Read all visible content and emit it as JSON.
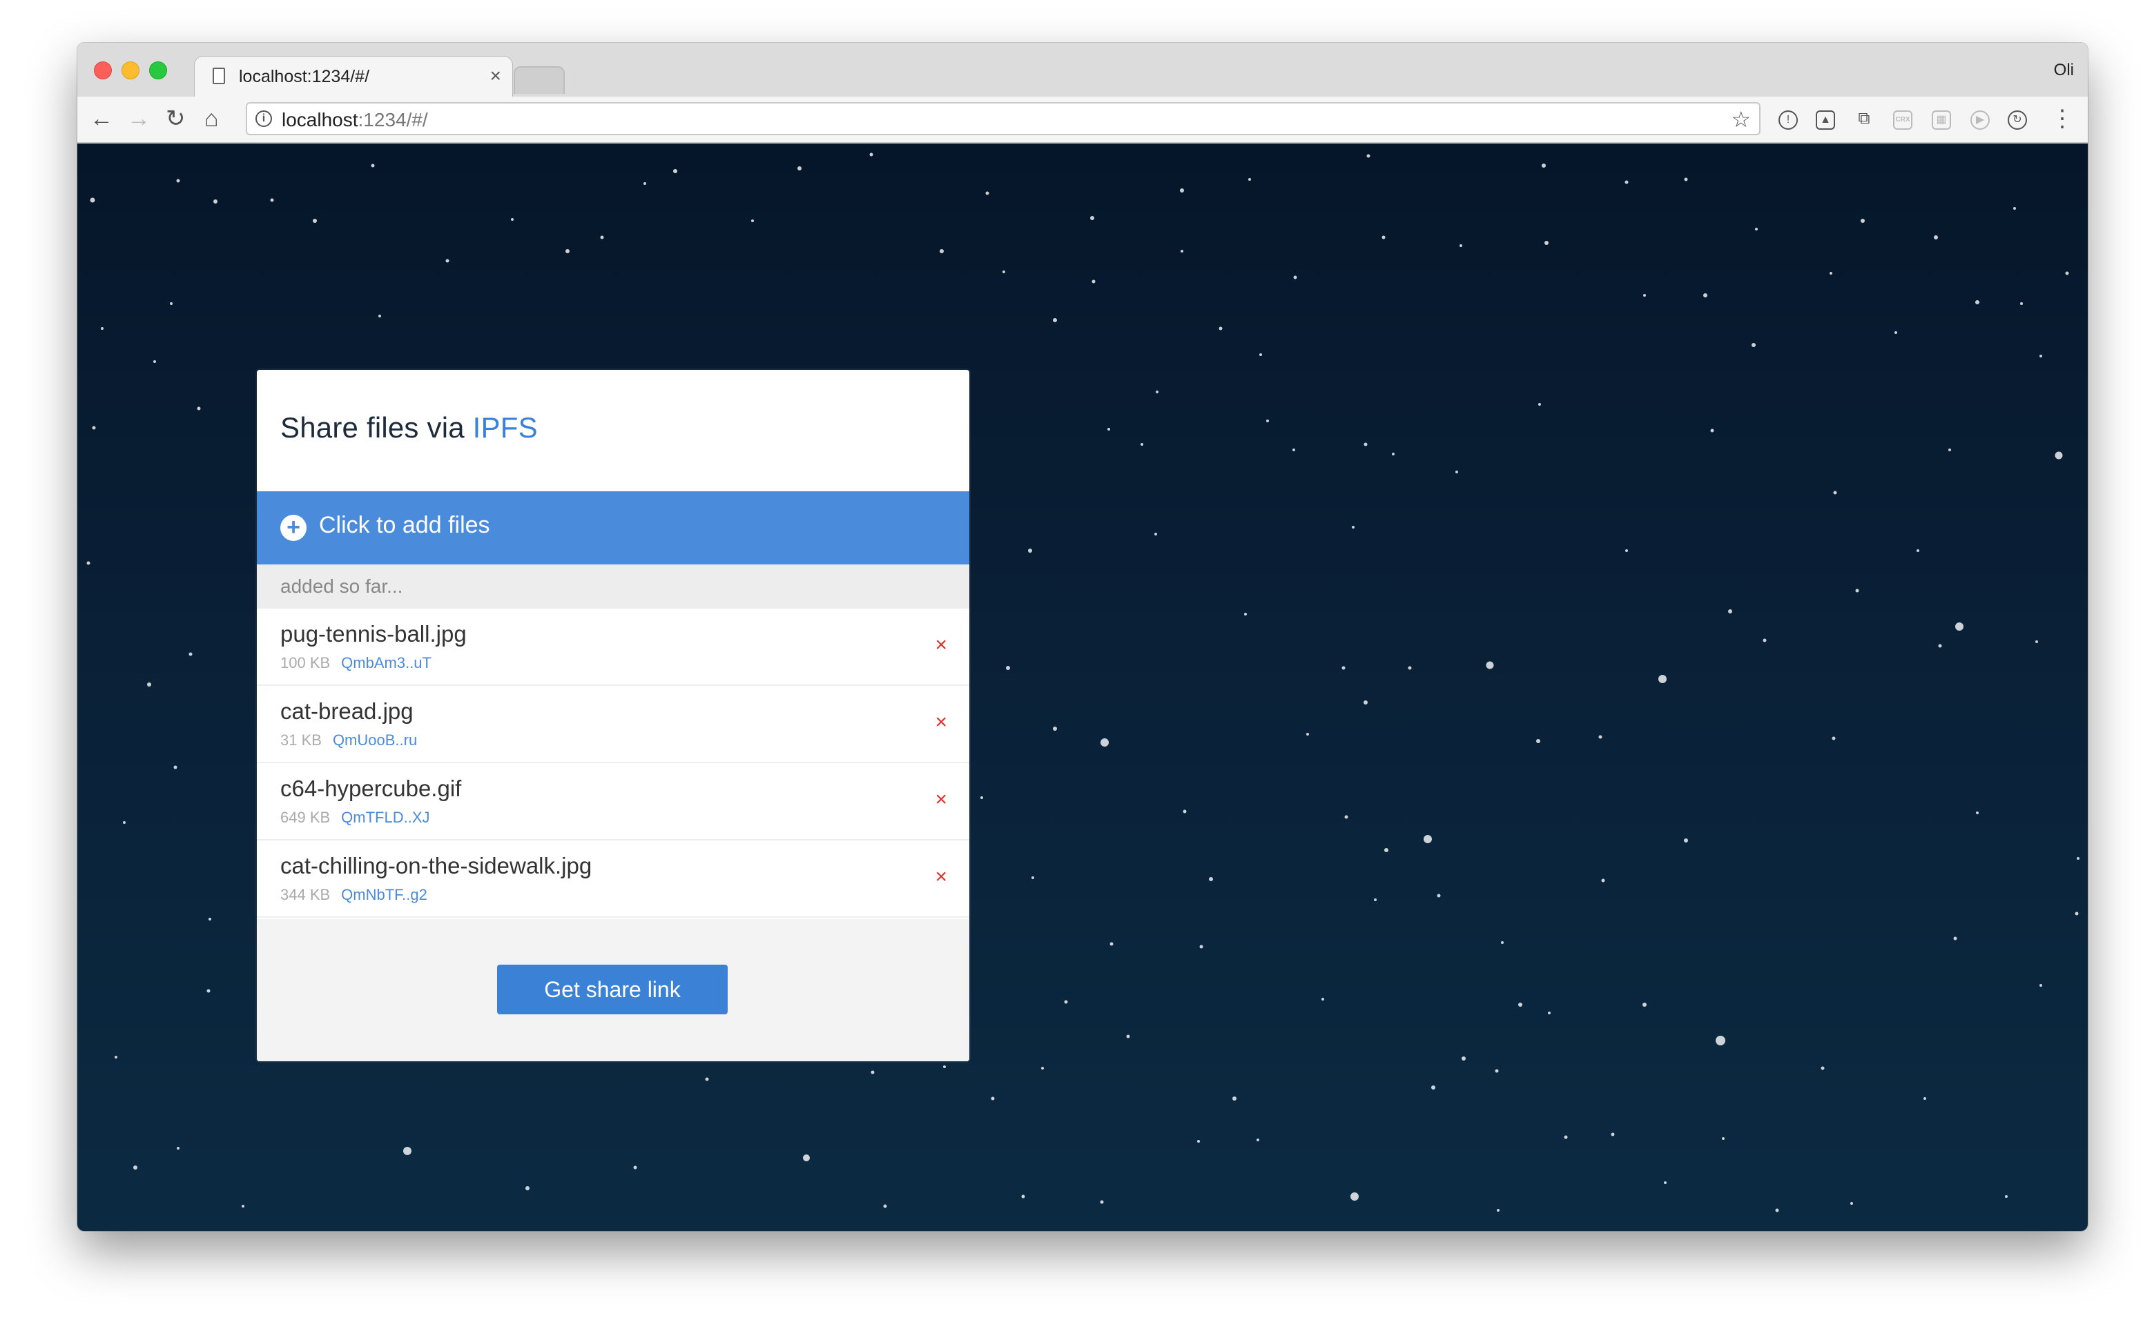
{
  "browser": {
    "tab_title": "localhost:1234/#/",
    "tab_close": "×",
    "profile_name": "Oli",
    "url_host": "localhost",
    "url_rest": ":1234/#/",
    "extensions": [
      "1password-icon",
      "bitwarden-icon",
      "cast-icon",
      "crx-icon",
      "grid-extension-icon",
      "play-extension-icon",
      "sync-extension-icon"
    ],
    "crx_label": "CRX"
  },
  "app": {
    "title_prefix": "Share files via ",
    "title_accent": "IPFS",
    "add_button": "Click to add files",
    "list_label": "added so far...",
    "files": [
      {
        "name": "pug-tennis-ball.jpg",
        "size": "100 KB",
        "hash": "QmbAm3..uT"
      },
      {
        "name": "cat-bread.jpg",
        "size": "31 KB",
        "hash": "QmUooB..ru"
      },
      {
        "name": "c64-hypercube.gif",
        "size": "649 KB",
        "hash": "QmTFLD..XJ"
      },
      {
        "name": "cat-chilling-on-the-sidewalk.jpg",
        "size": "344 KB",
        "hash": "QmNbTF..g2"
      }
    ],
    "remove_glyph": "×",
    "share_button": "Get share link"
  },
  "colors": {
    "accent": "#3b82d6",
    "add_bar": "#4a8bdc",
    "remove": "#e0302b",
    "background_top": "#06162a",
    "background_bottom": "#0b2a42"
  }
}
